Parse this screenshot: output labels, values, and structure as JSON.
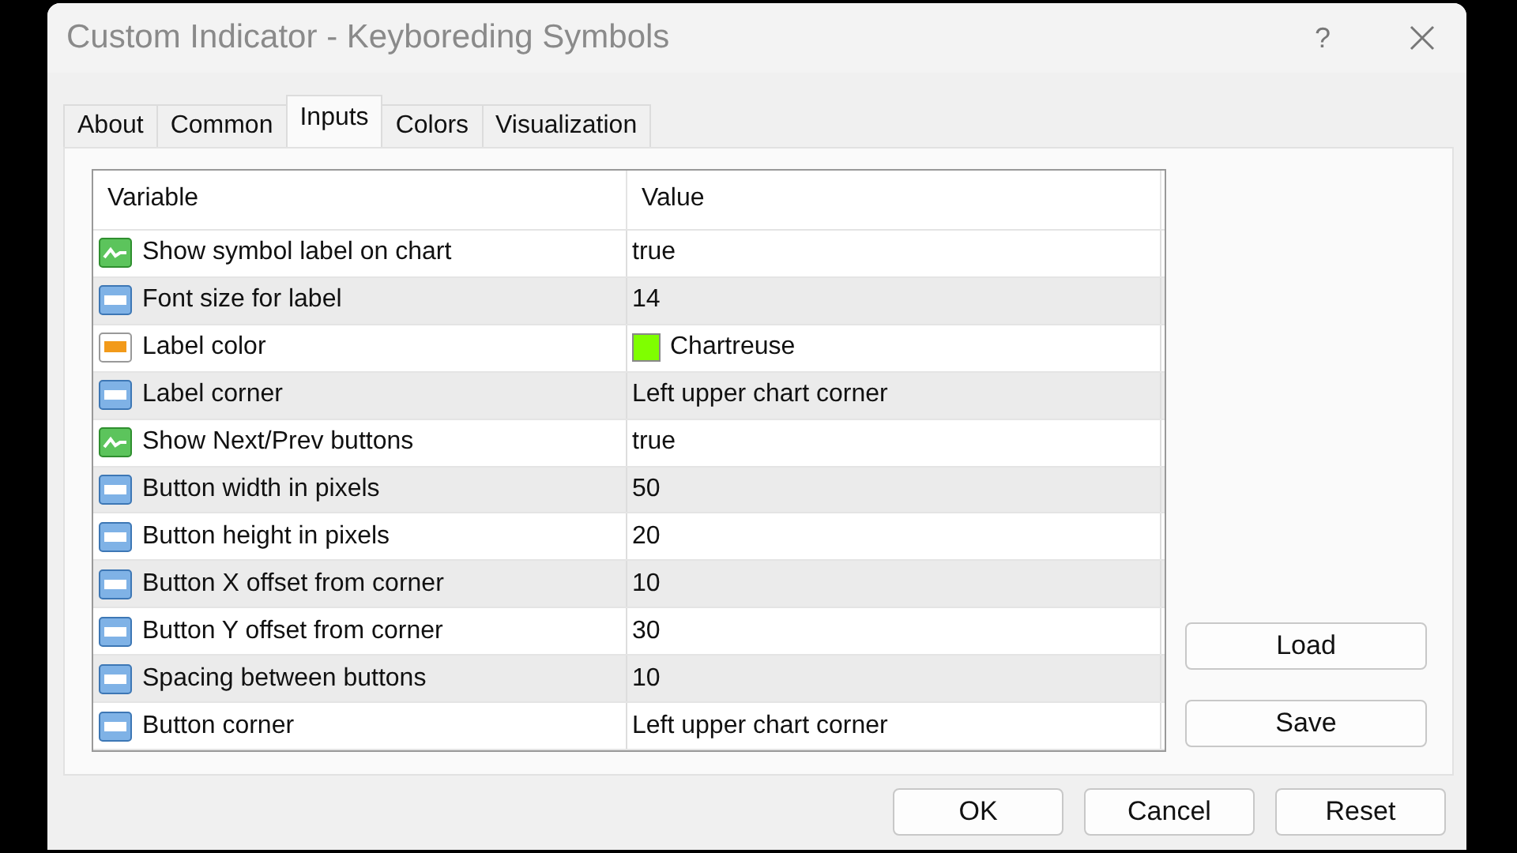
{
  "window": {
    "title": "Custom Indicator - Keyboreding Symbols",
    "help": "?"
  },
  "tabs": [
    {
      "label": "About",
      "selected": false
    },
    {
      "label": "Common",
      "selected": false
    },
    {
      "label": "Inputs",
      "selected": true
    },
    {
      "label": "Colors",
      "selected": false
    },
    {
      "label": "Visualization",
      "selected": false
    }
  ],
  "table": {
    "columns": [
      "Variable",
      "Value"
    ],
    "rows": [
      {
        "kind": "bool",
        "variable": "Show symbol label on chart",
        "value": "true"
      },
      {
        "kind": "int",
        "variable": "Font size for label",
        "value": "14"
      },
      {
        "kind": "color",
        "variable": "Label color",
        "value": "Chartreuse",
        "color": "#7fff00"
      },
      {
        "kind": "int",
        "variable": "Label corner",
        "value": "Left upper chart corner"
      },
      {
        "kind": "bool",
        "variable": "Show Next/Prev buttons",
        "value": "true"
      },
      {
        "kind": "int",
        "variable": "Button width in pixels",
        "value": "50"
      },
      {
        "kind": "int",
        "variable": "Button height in pixels",
        "value": "20"
      },
      {
        "kind": "int",
        "variable": "Button X offset from corner",
        "value": "10"
      },
      {
        "kind": "int",
        "variable": "Button Y offset from corner",
        "value": "30"
      },
      {
        "kind": "int",
        "variable": "Spacing between buttons",
        "value": "10"
      },
      {
        "kind": "int",
        "variable": "Button corner",
        "value": "Left upper chart corner"
      }
    ]
  },
  "side_buttons": [
    "Load",
    "Save"
  ],
  "buttons": [
    "OK",
    "Cancel",
    "Reset"
  ]
}
